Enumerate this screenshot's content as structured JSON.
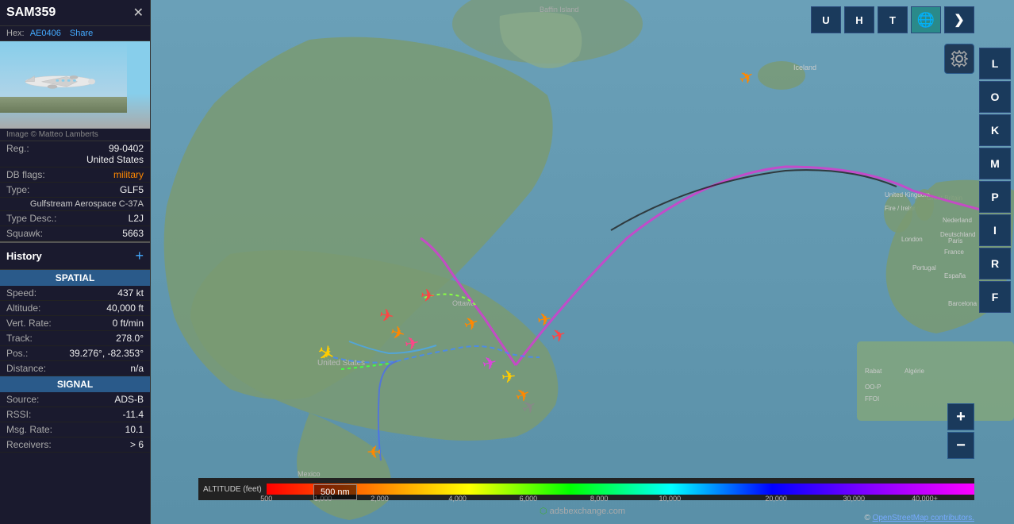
{
  "sidebar": {
    "title": "SAM359",
    "close_label": "✕",
    "hex_label": "Hex:",
    "hex_value": "AE0406",
    "share_label": "Share",
    "image_credit": "Image © Matteo Lamberts",
    "fields": [
      {
        "label": "Reg.:",
        "value": "99-0402",
        "value2": "United States"
      },
      {
        "label": "DB flags:",
        "value": "military"
      },
      {
        "label": "Type:",
        "value": "GLF5"
      },
      {
        "label": "Gulfstream Aerospace C-37A",
        "value": ""
      },
      {
        "label": "Type Desc.:",
        "value": "L2J"
      },
      {
        "label": "Squawk:",
        "value": "5663"
      }
    ],
    "history_title": "History",
    "history_add": "+",
    "spatial_title": "SPATIAL",
    "spatial_fields": [
      {
        "label": "Speed:",
        "value": "437 kt"
      },
      {
        "label": "Altitude:",
        "value": "40,000 ft"
      },
      {
        "label": "Vert. Rate:",
        "value": "0 ft/min"
      },
      {
        "label": "Track:",
        "value": "278.0°"
      },
      {
        "label": "Pos.:",
        "value": "39.276°, -82.353°"
      },
      {
        "label": "Distance:",
        "value": "n/a"
      }
    ],
    "signal_title": "SIGNAL",
    "signal_fields": [
      {
        "label": "Source:",
        "value": "ADS-B"
      },
      {
        "label": "RSSI:",
        "value": "-11.4"
      },
      {
        "label": "Msg. Rate:",
        "value": "10.1"
      },
      {
        "label": "Receivers:",
        "value": "> 6"
      }
    ]
  },
  "top_nav": [
    {
      "label": "U",
      "active": false
    },
    {
      "label": "H",
      "active": false
    },
    {
      "label": "T",
      "active": false
    },
    {
      "label": "🌐",
      "active": true,
      "class": "globe"
    }
  ],
  "right_panel": [
    {
      "label": "L"
    },
    {
      "label": "O"
    },
    {
      "label": "K"
    },
    {
      "label": "M"
    },
    {
      "label": "P"
    },
    {
      "label": "I"
    },
    {
      "label": "R"
    },
    {
      "label": "F"
    }
  ],
  "altitude_bar": {
    "label": "ALTITUDE (feet)",
    "ticks": [
      "500",
      "1,000",
      "2,000",
      "4,000",
      "6,000",
      "8,000",
      "10,000",
      "20,000",
      "30,000",
      "40,000+"
    ]
  },
  "scale_bar": "500 nm",
  "adsbexchange": "adsbexchange.com",
  "osm_credit": "© OpenStreetMap contributors.",
  "zoom_in": "+",
  "zoom_out": "−"
}
